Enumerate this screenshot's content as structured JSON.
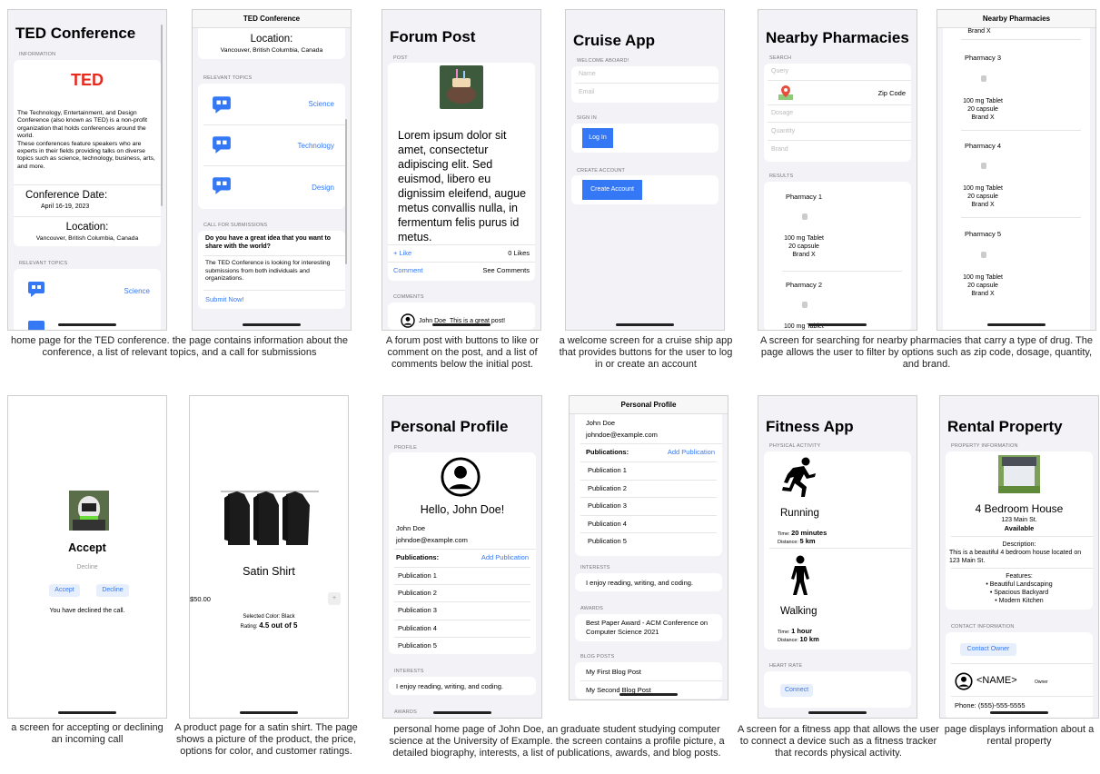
{
  "ted": {
    "title": "TED Conference",
    "info_header": "INFORMATION",
    "logo": "TED",
    "description": "The Technology, Entertainment, and Design Conference (also known as TED) is a non-profit organization that holds conferences around the world.\nThese conferences feature speakers who are experts in their fields providing talks on diverse topics such as science, technology, business, arts, and more.",
    "date_label": "Conference Date:",
    "date_value": "April 16-19, 2023",
    "location_label": "Location:",
    "location_value": "Vancouver, British Columbia, Canada",
    "topics_header": "RELEVANT TOPICS",
    "topics": [
      "Science",
      "Technology",
      "Design"
    ],
    "call_header": "CALL FOR SUBMISSIONS",
    "call_question": "Do you have a great idea that you want to share with the world?",
    "call_body": "The TED Conference is looking for interesting submissions from both individuals and organizations.",
    "submit": "Submit Now!",
    "caption": "home page for the TED conference. the page contains information about the conference, a list of relevant topics, and a call for submissions"
  },
  "forum": {
    "title": "Forum Post",
    "post_header": "POST",
    "body": "Lorem ipsum dolor sit amet, consectetur adipiscing elit. Sed euismod, libero eu dignissim eleifend, augue metus convallis nulla, in fermentum felis purus id metus.",
    "like": "+ Like",
    "likes": "0 Likes",
    "comment": "Comment",
    "see": "See Comments",
    "comments_header": "COMMENTS",
    "c_user": "John Doe",
    "c_text": "This is a great post!",
    "caption": "A forum post with buttons to like or comment on the post, and a list of comments below the initial post."
  },
  "cruise": {
    "title": "Cruise App",
    "welcome": "WELCOME ABOARD!",
    "name_ph": "Name",
    "email_ph": "Email",
    "signin": "SIGN IN",
    "login": "Log In",
    "create_header": "CREATE ACCOUNT",
    "create": "Create Account",
    "caption": "a welcome screen for a cruise ship app that provides buttons for the user to log in or create an account"
  },
  "pharm": {
    "title": "Nearby Pharmacies",
    "search": "SEARCH",
    "query": "Query",
    "zip": "Zip Code",
    "dosage": "Dosage",
    "quantity": "Quantity",
    "brand": "Brand",
    "results": "RESULTS",
    "p1": "Pharmacy 1",
    "p2": "Pharmacy 2",
    "p3": "Pharmacy 3",
    "p4": "Pharmacy 4",
    "p5": "Pharmacy 5",
    "l1": "100 mg Tablet",
    "l2": "20 capsule",
    "l3": "Brand X",
    "cut": "100 mg Tablet",
    "top_cut": "Brand X",
    "caption": "A screen for searching for nearby pharmacies that carry a type of drug. The page allows the user to filter by options such as zip code, dosage, quantity, and brand."
  },
  "call": {
    "accept_title": "Accept",
    "decline": "Decline",
    "btn_accept": "Accept",
    "btn_decline": "Decline",
    "status": "You have declined the call.",
    "caption": "a screen for accepting or declining an incoming call"
  },
  "shirt": {
    "name": "Satin Shirt",
    "price": "$50.00",
    "plus": "+",
    "color": "Selected Color: Black",
    "rating_label": "Rating:",
    "rating": "4.5 out of 5",
    "caption": "A product page for a satin shirt. The page shows a picture of the product, the price, options for color, and customer ratings."
  },
  "profile": {
    "title": "Personal Profile",
    "profile_header": "PROFILE",
    "hello": "Hello, John Doe!",
    "name": "John Doe",
    "email": "johndoe@example.com",
    "pubs_label": "Publications:",
    "add_pub": "Add Publication",
    "pubs": [
      "Publication 1",
      "Publication 2",
      "Publication 3",
      "Publication 4",
      "Publication 5"
    ],
    "interests_header": "INTERESTS",
    "interests": "I enjoy reading, writing, and coding.",
    "awards_header": "AWARDS",
    "award": "Best Paper Award - ACM Conference on Computer Science 2021",
    "blog_header": "BLOG POSTS",
    "blog": [
      "My First Blog Post",
      "My Second Blog Post"
    ],
    "caption": "personal home page of John Doe, an graduate student studying computer science at the University of Example. the screen contains a profile picture, a detailed biography, interests, a list of publications, awards, and blog posts."
  },
  "fitness": {
    "title": "Fitness App",
    "pa_header": "PHYSICAL ACTIVITY",
    "running": "Running",
    "time_label": "Time:",
    "run_time": "20 minutes",
    "dist_label": "Distance:",
    "run_dist": "5 km",
    "walking": "Walking",
    "walk_time": "1 hour",
    "walk_dist": "10 km",
    "hr_header": "HEART RATE",
    "connect": "Connect",
    "caption": "A screen for a fitness app that allows the user to connect a device such as a fitness tracker that records physical activity."
  },
  "rental": {
    "title": "Rental Property",
    "info_header": "PROPERTY INFORMATION",
    "house": "4 Bedroom House",
    "address": "123 Main St.",
    "available": "Available",
    "desc_label": "Description:",
    "desc": "This is a beautiful 4 bedroom house located on 123 Main St.",
    "features_label": "Features:",
    "features": [
      "• Beautiful Landscaping",
      "• Spacious Backyard",
      "• Modern Kitchen"
    ],
    "contact_header": "CONTACT INFORMATION",
    "contact_btn": "Contact Owner",
    "owner_name": "<NAME>",
    "owner_tag": "Owner",
    "phone": "Phone: (555)-555-5555",
    "caption": "page displays information about a rental property"
  },
  "colors": {
    "accent": "#3478f6",
    "ted_red": "#e62b1e"
  }
}
